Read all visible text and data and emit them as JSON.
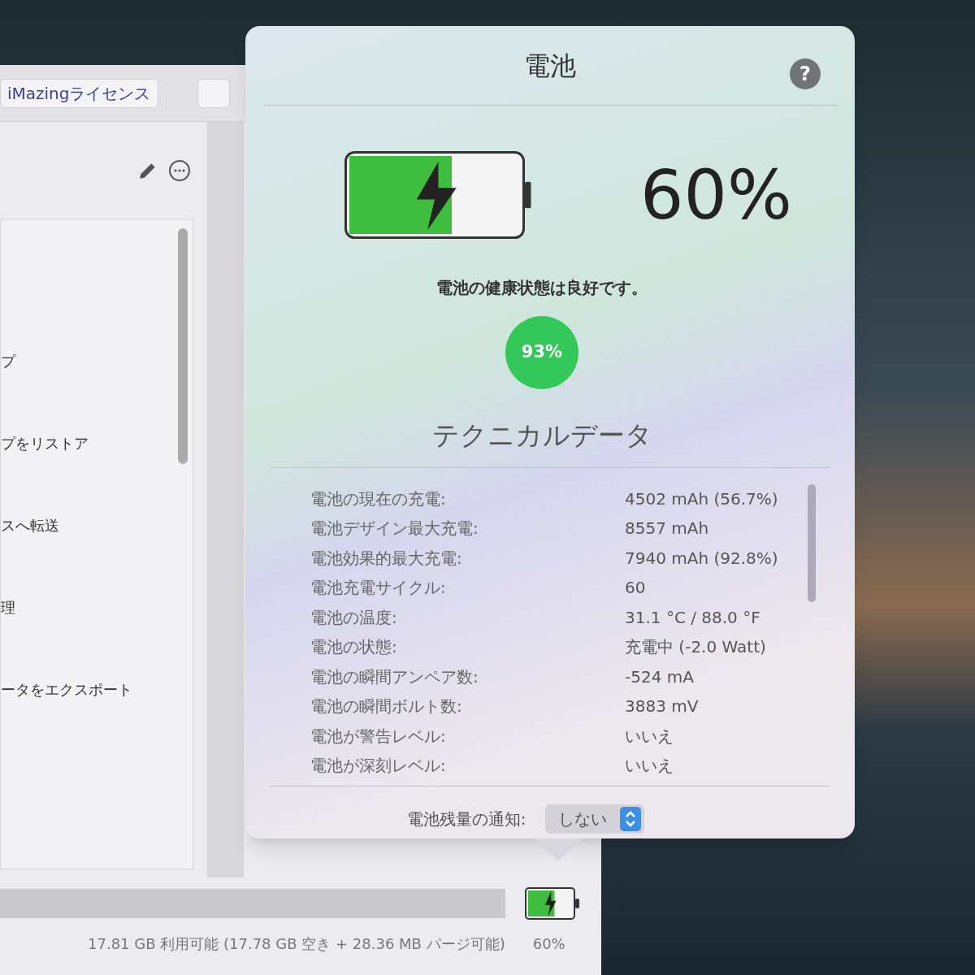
{
  "background_window": {
    "tab_label": "iMazingライセンス",
    "list_items": [
      "プ",
      "プをリストア",
      "スへ転送",
      "理",
      "ータをエクスポート"
    ],
    "storage_text": "17.81 GB 利用可能 (17.78 GB 空き + 28.36 MB パージ可能)",
    "battery_indicator": {
      "level": 0.6,
      "charging": true,
      "percent": "60%"
    }
  },
  "popover": {
    "title": "電池",
    "help_label": "?",
    "battery": {
      "level": 0.6,
      "charging": true,
      "percent": "60%"
    },
    "health_text": "電池の健康状態は良好です。",
    "health_percent": "93%",
    "section_title": "テクニカルデータ",
    "rows": [
      {
        "label": "電池の現在の充電:",
        "value": "4502 mAh (56.7%)"
      },
      {
        "label": "電池デザイン最大充電:",
        "value": "8557 mAh"
      },
      {
        "label": "電池効果的最大充電:",
        "value": "7940 mAh (92.8%)"
      },
      {
        "label": "電池充電サイクル:",
        "value": "60"
      },
      {
        "label": "電池の温度:",
        "value": "31.1 °C / 88.0 °F"
      },
      {
        "label": "電池の状態:",
        "value": "充電中 (-2.0 Watt)"
      },
      {
        "label": "電池の瞬間アンペア数:",
        "value": "-524 mA"
      },
      {
        "label": "電池の瞬間ボルト数:",
        "value": "3883 mV"
      },
      {
        "label": "電池が警告レベル:",
        "value": "いいえ"
      },
      {
        "label": "電池が深刻レベル:",
        "value": "いいえ"
      }
    ],
    "notification": {
      "label": "電池残量の通知:",
      "value": "しない"
    }
  }
}
